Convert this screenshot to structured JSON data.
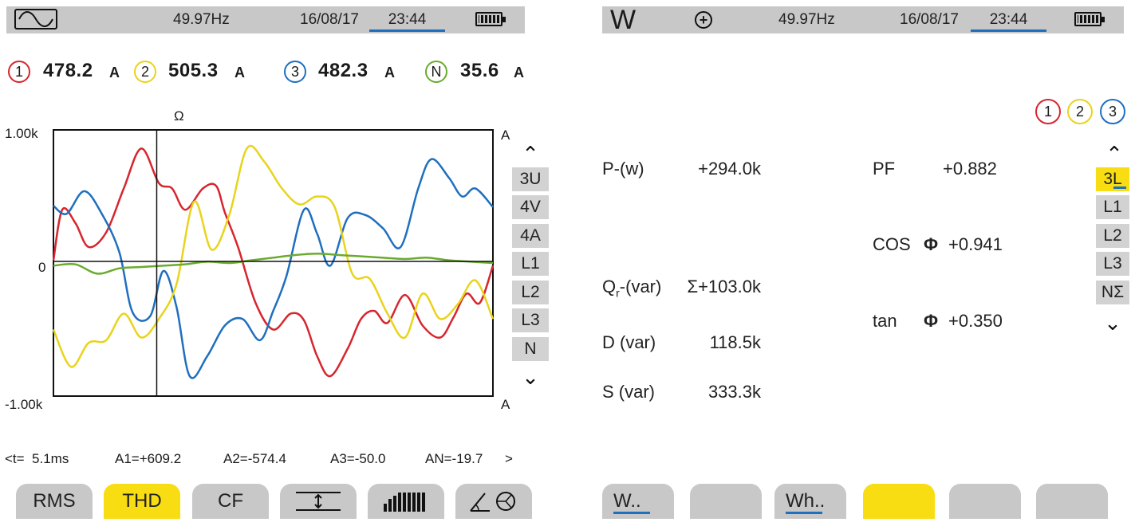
{
  "left": {
    "status": {
      "frequency": "49.97Hz",
      "date": "16/08/17",
      "time": "23:44"
    },
    "readings": [
      {
        "channel": "1",
        "value": "478.2",
        "unit": "A",
        "color": "#d6262e"
      },
      {
        "channel": "2",
        "value": "505.3",
        "unit": "A",
        "color": "#e8d41c"
      },
      {
        "channel": "3",
        "value": "482.3",
        "unit": "A",
        "color": "#1f6fbf"
      },
      {
        "channel": "N",
        "value": "35.6",
        "unit": "A",
        "color": "#6aab2e"
      }
    ],
    "cursor_symbol": "Ω",
    "axis": {
      "top": "1.00k",
      "zero": "0",
      "bottom": "-1.00k",
      "unit_top": "A",
      "unit_bottom": "A"
    },
    "side_buttons": [
      "3U",
      "4V",
      "4A",
      "L1",
      "L2",
      "L3",
      "N"
    ],
    "active_side_button": "3U",
    "cursor_readout": {
      "t": "<t=  5.1ms",
      "a1": "A1=+609.2",
      "a2": "A2=-574.4",
      "a3": "A3=-50.0",
      "an": "AN=-19.7",
      "next": ">"
    },
    "tabs": [
      "RMS",
      "THD",
      "CF",
      "",
      "",
      ""
    ],
    "active_tab": "THD"
  },
  "right": {
    "status": {
      "mode_letter": "W",
      "frequency": "49.97Hz",
      "date": "16/08/17",
      "time": "23:44"
    },
    "phase_indicators": [
      "1",
      "2",
      "3"
    ],
    "measurements": {
      "p_label": "P-(w)",
      "p_value": "+294.0k",
      "q_label_main": "Q",
      "q_label_sub": "r",
      "q_label_rest": "-(var)",
      "q_value": "Σ+103.0k",
      "d_label": "D (var)",
      "d_value": "118.5k",
      "s_label": "S (var)",
      "s_value": "333.3k",
      "pf_label": "PF",
      "pf_value": "+0.882",
      "cos_label": "COS",
      "cos_symbol": "Φ",
      "cos_value": "+0.941",
      "tan_label": "tan",
      "tan_symbol": "Φ",
      "tan_value": "+0.350"
    },
    "side_buttons": [
      "3L",
      "L1",
      "L2",
      "L3",
      "NΣ"
    ],
    "active_side_button": "3L",
    "tabs": [
      "W..",
      "",
      "Wh..",
      "",
      "",
      ""
    ]
  },
  "chart_data": {
    "type": "line",
    "ylim": [
      -1000,
      1000
    ],
    "cursor_x": 0.235,
    "series": [
      {
        "color": "#d6262e",
        "x": [
          0,
          0.02,
          0.05,
          0.08,
          0.12,
          0.16,
          0.2,
          0.24,
          0.27,
          0.3,
          0.34,
          0.37,
          0.39,
          0.42,
          0.46,
          0.5,
          0.54,
          0.57,
          0.6,
          0.63,
          0.67,
          0.7,
          0.73,
          0.76,
          0.8,
          0.84,
          0.88,
          0.91,
          0.94,
          0.97,
          1.0
        ],
        "y": [
          20,
          400,
          300,
          120,
          230,
          560,
          860,
          600,
          560,
          400,
          560,
          580,
          380,
          120,
          -300,
          -500,
          -380,
          -430,
          -700,
          -850,
          -640,
          -420,
          -360,
          -450,
          -240,
          -470,
          -560,
          -410,
          -230,
          -300,
          -20
        ]
      },
      {
        "color": "#1f6fbf",
        "x": [
          0,
          0.03,
          0.07,
          0.11,
          0.15,
          0.18,
          0.22,
          0.25,
          0.28,
          0.31,
          0.35,
          0.39,
          0.43,
          0.47,
          0.5,
          0.53,
          0.57,
          0.6,
          0.63,
          0.67,
          0.71,
          0.75,
          0.79,
          0.83,
          0.86,
          0.9,
          0.93,
          0.96,
          1.0
        ],
        "y": [
          430,
          370,
          540,
          370,
          80,
          -370,
          -400,
          -60,
          -330,
          -850,
          -700,
          -470,
          -420,
          -580,
          -360,
          -100,
          400,
          220,
          -20,
          340,
          360,
          260,
          120,
          560,
          780,
          640,
          500,
          560,
          420
        ]
      },
      {
        "color": "#e8d41c",
        "x": [
          0,
          0.04,
          0.08,
          0.12,
          0.16,
          0.2,
          0.24,
          0.28,
          0.32,
          0.36,
          0.4,
          0.44,
          0.48,
          0.52,
          0.56,
          0.6,
          0.64,
          0.68,
          0.72,
          0.76,
          0.8,
          0.84,
          0.88,
          0.92,
          0.96,
          1.0
        ],
        "y": [
          -500,
          -780,
          -600,
          -580,
          -380,
          -560,
          -420,
          -160,
          460,
          100,
          360,
          860,
          760,
          560,
          440,
          500,
          420,
          -80,
          -120,
          -380,
          -560,
          -230,
          -420,
          -310,
          -130,
          -420
        ]
      },
      {
        "color": "#6aab2e",
        "x": [
          0,
          0.05,
          0.1,
          0.15,
          0.2,
          0.25,
          0.3,
          0.35,
          0.4,
          0.45,
          0.5,
          0.55,
          0.6,
          0.65,
          0.7,
          0.75,
          0.8,
          0.85,
          0.9,
          0.95,
          1.0
        ],
        "y": [
          -20,
          -10,
          -80,
          -40,
          -30,
          -20,
          -10,
          10,
          0,
          20,
          40,
          60,
          70,
          60,
          50,
          40,
          30,
          40,
          20,
          10,
          0
        ]
      }
    ]
  }
}
